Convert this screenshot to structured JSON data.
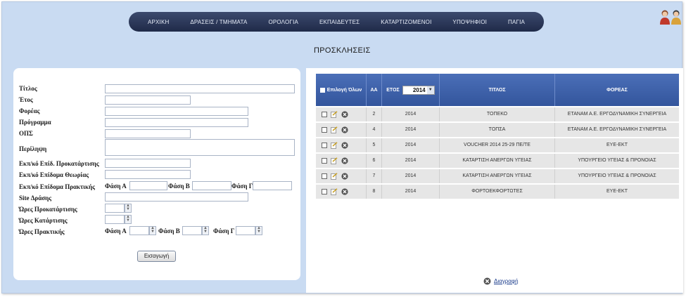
{
  "nav": {
    "items": [
      "ΑΡΧΙΚΗ",
      "ΔΡΑΣΕΙΣ / ΤΜΗΜΑΤΑ",
      "ΟΡΟΛΟΓΙΑ",
      "ΕΚΠΑΙΔΕΥΤΕΣ",
      "ΚΑΤΑΡΤΙΖΟΜΕΝΟΙ",
      "ΥΠΟΨΗΦΙΟΙ",
      "ΠΑΓΙΑ"
    ]
  },
  "page_title": "ΠΡΟΣΚΛΗΣΕΙΣ",
  "form": {
    "labels": {
      "title": "Τίτλος",
      "year": "Έτος",
      "body": "Φορέας",
      "program": "Πρόγραμμα",
      "ops": "ΟΠΣ",
      "summary": "Περίληψη",
      "prep_allowance": "Εκπ/κό Επίδ. Προκατάρτισης",
      "theory_allowance": "Εκπ/κό Επίδομα Θεωρίας",
      "practice_allowance": "Εκπ/κό Επίδομα Πρακτικής",
      "site": "Site Δράσης",
      "prep_hours": "Ώρες Προκατάρτισης",
      "training_hours": "Ώρες Κατάρτισης",
      "practice_hours": "Ώρες Πρακτικής"
    },
    "phase_a": "Φάση Α",
    "phase_b": "Φάση Β",
    "phase_c": "Φάση Γ",
    "submit": "Εισαγωγή"
  },
  "table": {
    "select_all": "Επιλογή Όλων",
    "col_aa": "ΑΑ",
    "col_year": "ΕΤΟΣ",
    "year_selected": "2014",
    "col_title": "ΤΙΤΛΟΣ",
    "col_bodies": "ΦΟΡΕΑΣ",
    "rows": [
      {
        "aa": "2",
        "year": "2014",
        "title": "ΤΟΠΕΚΟ",
        "body": "ΕΤΑΝΑΜ Α.Ε. ΕΡΓΟΔΥΝΑΜΙΚΗ ΣΥΝΕΡΓΕΙΑ"
      },
      {
        "aa": "4",
        "year": "2014",
        "title": "ΤΟΠΣΑ",
        "body": "ΕΤΑΝΑΜ Α.Ε. ΕΡΓΟΔΥΝΑΜΙΚΗ ΣΥΝΕΡΓΕΙΑ"
      },
      {
        "aa": "5",
        "year": "2014",
        "title": "VOUCHER 2014 25-29 ΠΕ/ΤΕ",
        "body": "ΕΥΕ-ΕΚΤ"
      },
      {
        "aa": "6",
        "year": "2014",
        "title": "ΚΑΤΑΡΤΙΣΗ ΑΝΕΡΓΩΝ ΥΓΕΙΑΣ",
        "body": "ΥΠΟΥΡΓΕΙΟ ΥΓΕΙΑΣ & ΠΡΟΝΟΙΑΣ"
      },
      {
        "aa": "7",
        "year": "2014",
        "title": "ΚΑΤΑΡΤΙΣΗ ΑΝΕΡΓΩΝ ΥΓΕΙΑΣ",
        "body": "ΥΠΟΥΡΓΕΙΟ ΥΓΕΙΑΣ & ΠΡΟΝΟΙΑΣ"
      },
      {
        "aa": "8",
        "year": "2014",
        "title": "ΦΟΡΤΟΕΚΦΟΡΤΩΤΕΣ",
        "body": "ΕΥΕ-ΕΚΤ"
      }
    ],
    "delete_label": "Διαγραφή"
  }
}
